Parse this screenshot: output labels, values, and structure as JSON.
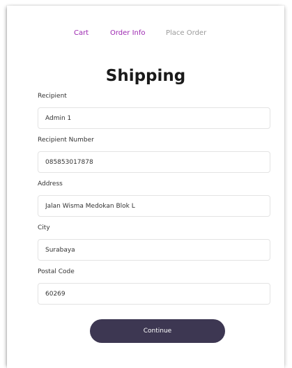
{
  "steps": [
    {
      "label": "Cart",
      "state": "active"
    },
    {
      "label": "Order Info",
      "state": "active"
    },
    {
      "label": "Place Order",
      "state": "inactive"
    }
  ],
  "title": "Shipping",
  "fields": {
    "recipient": {
      "label": "Recipient",
      "value": "Admin 1"
    },
    "recipient_number": {
      "label": "Recipient Number",
      "value": "085853017878"
    },
    "address": {
      "label": "Address",
      "value": "Jalan Wisma Medokan Blok L"
    },
    "city": {
      "label": "City",
      "value": "Surabaya"
    },
    "postal_code": {
      "label": "Postal Code",
      "value": "60269"
    }
  },
  "continue_label": "Continue",
  "colors": {
    "active_step": "#9c27b0",
    "inactive_step": "#9a9a9a",
    "button_bg": "#3d3752"
  }
}
